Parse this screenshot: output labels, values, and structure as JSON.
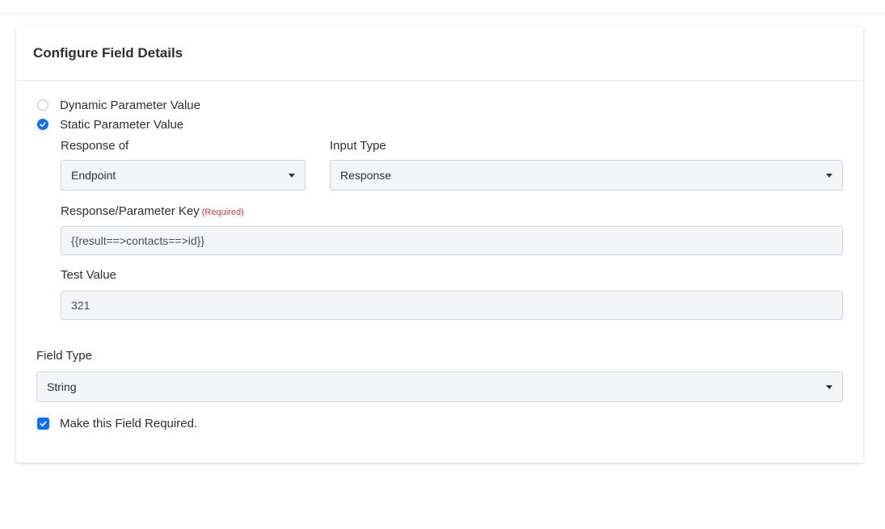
{
  "card": {
    "title": "Configure Field Details"
  },
  "parameter_mode": {
    "options": [
      {
        "label": "Dynamic Parameter Value",
        "checked": false
      },
      {
        "label": "Static Parameter Value",
        "checked": true
      }
    ]
  },
  "response_of": {
    "label": "Response of",
    "value": "Endpoint"
  },
  "input_type": {
    "label": "Input Type",
    "value": "Response"
  },
  "response_key": {
    "label": "Response/Parameter Key",
    "required_text": "(Required)",
    "value": "{{result==>contacts==>id}}"
  },
  "test_value": {
    "label": "Test Value",
    "value": "321"
  },
  "field_type": {
    "label": "Field Type",
    "value": "String"
  },
  "required_checkbox": {
    "label": "Make this Field Required.",
    "checked": true
  },
  "colors": {
    "accent": "#0d6efd",
    "required": "#d0363f",
    "control_bg": "#f3f5f8"
  },
  "icons": {
    "radio_checked": "check-icon",
    "dropdown": "caret-down-icon"
  }
}
